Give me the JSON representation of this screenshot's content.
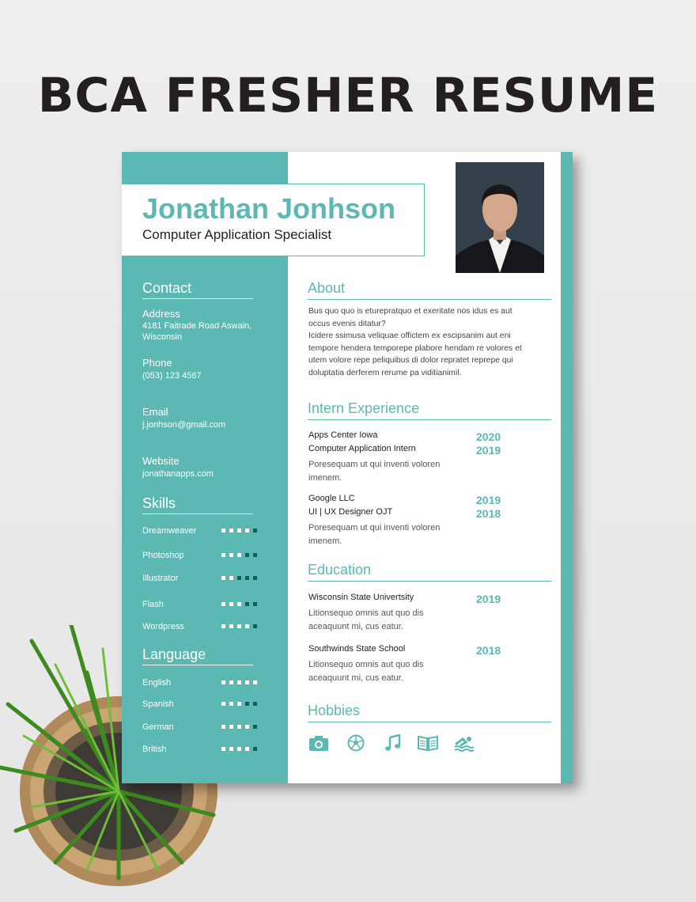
{
  "hero_title": "BCA FRESHER RESUME",
  "resume": {
    "name": "Jonathan Jonhson",
    "role": "Computer Application Specialist",
    "contact": {
      "heading": "Contact",
      "address_label": "Address",
      "address_line1": "4181 Faitrade Road Aswain,",
      "address_line2": "Wisconsin",
      "phone_label": "Phone",
      "phone_value": "(053) 123 4567",
      "email_label": "Email",
      "email_value": "j.jonhson@gmail.com",
      "website_label": "Website",
      "website_value": "jonathanapps.com"
    },
    "skills": {
      "heading": "Skills",
      "items": [
        {
          "name": "Dreamweaver",
          "level": 4
        },
        {
          "name": "Photoshop",
          "level": 3
        },
        {
          "name": "Illustrator",
          "level": 2
        },
        {
          "name": "Flash",
          "level": 3
        },
        {
          "name": "Wordpress",
          "level": 4
        }
      ]
    },
    "language": {
      "heading": "Language",
      "items": [
        {
          "name": "English",
          "level": 5
        },
        {
          "name": "Spanish",
          "level": 3
        },
        {
          "name": "German",
          "level": 4
        },
        {
          "name": "British",
          "level": 4
        }
      ]
    },
    "about": {
      "heading": "About",
      "lines": [
        "Bus quo quo is eturepratquo et exeritate nos idus es aut",
        "occus evenis ditatur?",
        "Icidere ssimusa veliquae offictem ex escipsanim aut eni",
        "tempore hendera temporepe plabore hendam re volores et",
        "utem volore repe peliquibus di dolor repratet reprepe qui",
        "doluptatia derferem rerume pa viditianimil."
      ]
    },
    "intern": {
      "heading": "Intern Experience",
      "items": [
        {
          "company": "Apps Center Iowa",
          "position": "Computer Application Intern",
          "year_end": "2020",
          "year_start": "2019",
          "desc1": "Poresequam ut qui inventi voloren",
          "desc2": "imenem."
        },
        {
          "company": "Google LLC",
          "position": "UI | UX Designer OJT",
          "year_end": "2019",
          "year_start": "2018",
          "desc1": "Poresequam ut qui inventi voloren",
          "desc2": "imenem."
        }
      ]
    },
    "education": {
      "heading": "Education",
      "items": [
        {
          "school": "Wisconsin State Univertsity",
          "year": "2019",
          "desc1": "Litionsequo omnis aut quo dis",
          "desc2": "aceaquunt mi, cus eatur."
        },
        {
          "school": "Southwinds State School",
          "year": "2018",
          "desc1": "Litionsequo omnis aut quo dis",
          "desc2": "aceaquunt mi, cus eatur."
        }
      ]
    },
    "hobbies": {
      "heading": "Hobbies",
      "icons": [
        "camera-icon",
        "soccer-ball-icon",
        "music-note-icon",
        "book-icon",
        "swimming-icon"
      ]
    }
  },
  "colors": {
    "accent": "#5cb8b2",
    "accent_dark": "#0d5f5b",
    "title": "#231f20"
  }
}
